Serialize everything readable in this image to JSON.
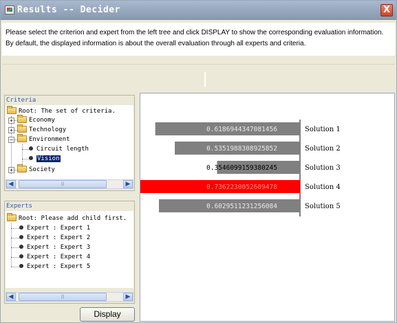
{
  "window": {
    "title": "Results -- Decider"
  },
  "info": {
    "text": "Please select the criterion and expert from the left tree and click DISPLAY to show the corresponding evaluation information. By default, the displayed information is about the overall evaluation through all experts and criteria."
  },
  "criteria": {
    "label": "Criteria",
    "root": "Root: The set of criteria.",
    "items": [
      {
        "label": "Economy",
        "expanded": false
      },
      {
        "label": "Technology",
        "expanded": false
      },
      {
        "label": "Environment",
        "expanded": true,
        "children": [
          "Circuit length",
          "Vision"
        ]
      },
      {
        "label": "Society",
        "expanded": false
      }
    ],
    "selected": "Vision"
  },
  "experts": {
    "label": "Experts",
    "root": "Root: Please add child first.",
    "items": [
      "Expert : Expert 1",
      "Expert : Expert 2",
      "Expert : Expert 3",
      "Expert : Expert 4",
      "Expert : Expert 5"
    ]
  },
  "buttons": {
    "display": "Display",
    "close": "X"
  },
  "colors": {
    "bar": "#808080",
    "highlight": "#ff0000",
    "selection": "#0a246a",
    "title_bar": "#98a9c1"
  },
  "chart_data": {
    "type": "bar",
    "orientation": "horizontal",
    "categories": [
      "Solution 1",
      "Solution 2",
      "Solution 3",
      "Solution 4",
      "Solution 5"
    ],
    "values": [
      0.6186944347081456,
      0.5351988308925852,
      0.3546099159380245,
      0.7362230052609477,
      0.6029511231256084
    ],
    "value_labels": [
      "0.6186944347081456",
      "0.5351988308925852",
      "0.3546099159380245",
      "0.7362230052609478",
      "0.6029511231256084"
    ],
    "highlight": "Solution 4",
    "xlim": [
      0,
      0.75
    ]
  }
}
